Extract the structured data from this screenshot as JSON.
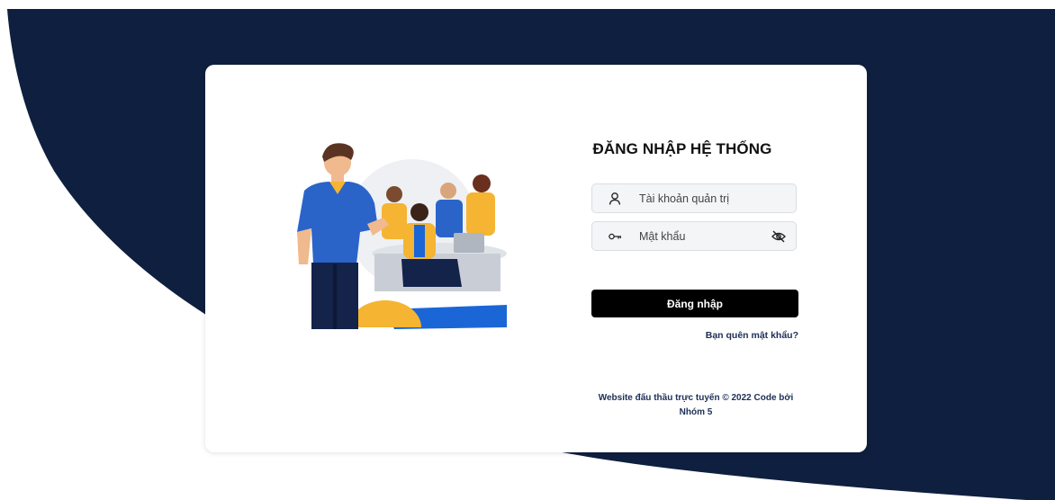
{
  "login": {
    "title": "ĐĂNG NHẬP HỆ THỐNG",
    "username_placeholder": "Tài khoản quản trị",
    "password_placeholder": "Mật khẩu",
    "submit_label": "Đăng nhập",
    "forgot_label": "Bạn quên mật khẩu?",
    "footer_text": "Website đấu thầu trực tuyến © 2022 Code bởi Nhóm 5"
  },
  "icons": {
    "username": "user-icon",
    "password": "key-icon",
    "toggle": "eye-slash-icon"
  },
  "colors": {
    "background_shape": "#0f1f3f",
    "button": "#000000",
    "link": "#1c2f55",
    "field_bg": "#f4f5f7"
  }
}
